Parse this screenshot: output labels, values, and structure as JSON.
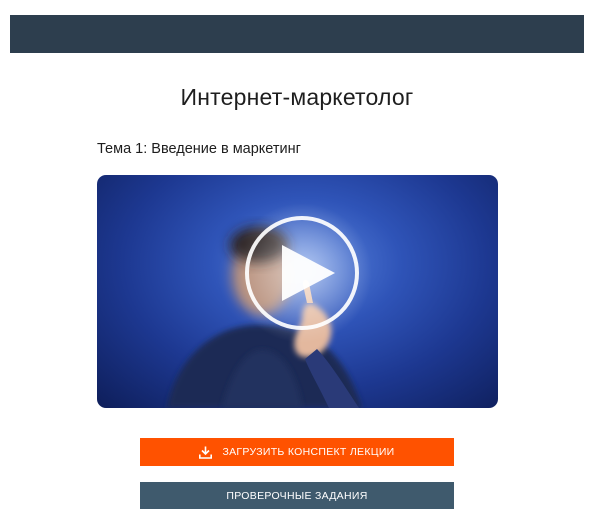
{
  "page": {
    "title": "Интернет-маркетолог",
    "lesson_title": "Тема 1: Введение в маркетинг"
  },
  "video": {
    "play_icon": "play-icon"
  },
  "buttons": {
    "download_label": "ЗАГРУЗИТЬ КОНСПЕКТ ЛЕКЦИИ",
    "download_icon": "download-icon",
    "tasks_label": "ПРОВЕРОЧНЫЕ ЗАДАНИЯ"
  },
  "colors": {
    "header_bar": "#2d3e4e",
    "download_button": "#ff5200",
    "tasks_button": "#3f5a6d"
  }
}
